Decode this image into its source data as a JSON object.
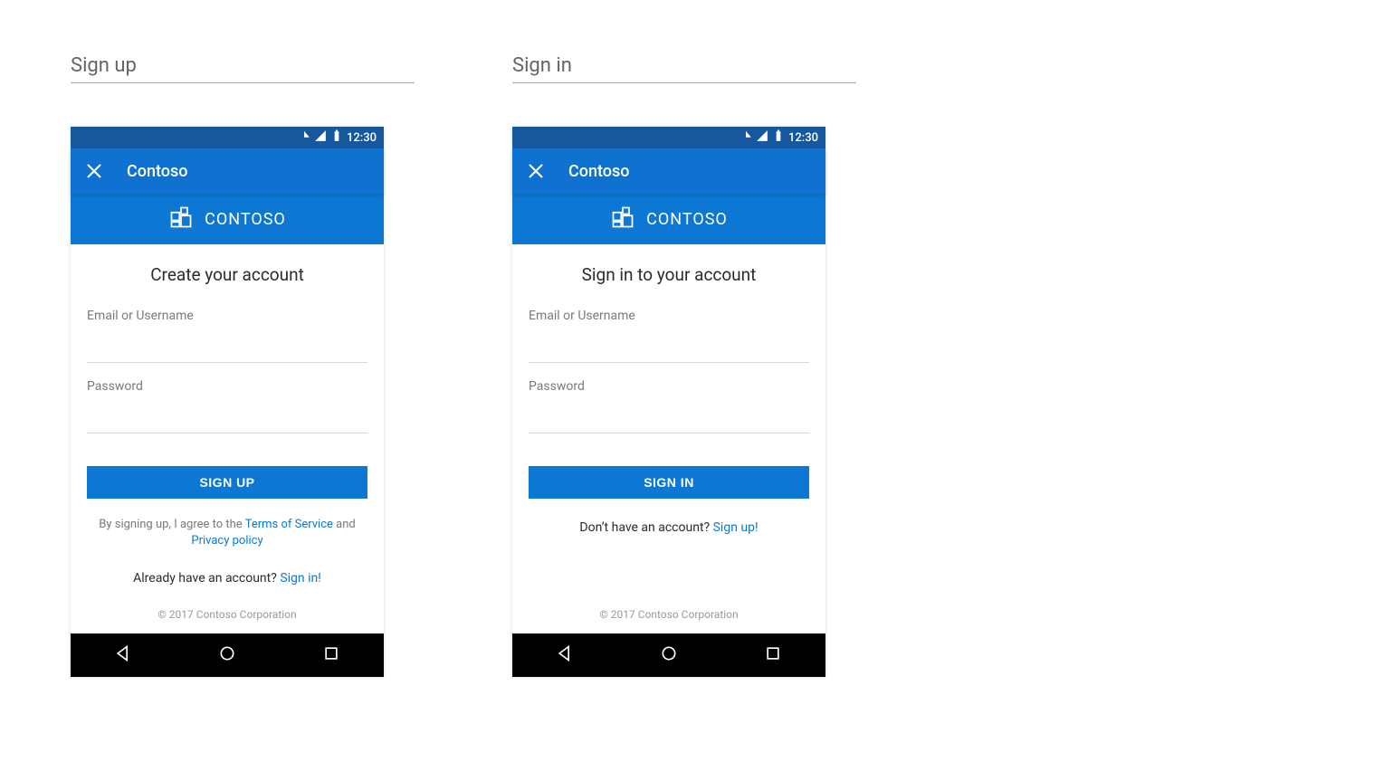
{
  "sections": {
    "signup_label": "Sign up",
    "signin_label": "Sign in"
  },
  "status": {
    "time": "12:30"
  },
  "appbar": {
    "title": "Contoso"
  },
  "banner": {
    "brand": "CONTOSO"
  },
  "signup": {
    "heading": "Create your account",
    "email_label": "Email or Username",
    "password_label": "Password",
    "button": "SIGN UP",
    "agree_pre": "By signing up, I agree to the ",
    "tos": "Terms of Service",
    "agree_mid": " and ",
    "privacy": "Privacy policy",
    "have_account": "Already have an account? ",
    "signin_link": "Sign in!"
  },
  "signin": {
    "heading": "Sign in to your account",
    "email_label": "Email or Username",
    "password_label": "Password",
    "button": "SIGN IN",
    "no_account": "Don’t have an account? ",
    "signup_link": "Sign up!"
  },
  "footer": {
    "copyright": "© 2017 Contoso Corporation"
  }
}
